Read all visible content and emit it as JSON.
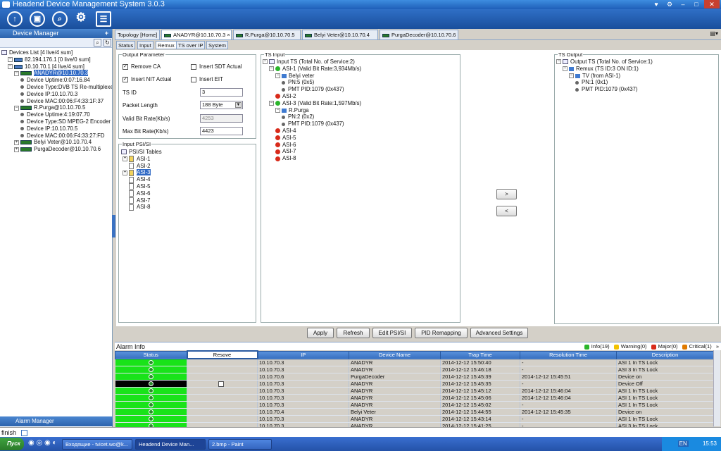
{
  "app": {
    "title": "Headend Device Management System 3.0.3",
    "window_controls": [
      "♥",
      "⚙",
      "–",
      "□",
      "✕"
    ]
  },
  "toolbar": {
    "icons": [
      "signal-icon",
      "monitor-icon",
      "search-icon",
      "settings-icon",
      "report-icon"
    ]
  },
  "left_panel": {
    "header": "Device Manager",
    "plus": "+",
    "tree": [
      {
        "label": "Devices List [4 live/4 sum]",
        "level": 0
      },
      {
        "label": "82.194.176.1 [0 live/0 sum]",
        "level": 1
      },
      {
        "label": "10.10.70.1 [4 live/4 sum]",
        "level": 1
      },
      {
        "label": "ANADYR@10.10.70.3",
        "level": 2,
        "selected": true
      },
      {
        "label": "Device Uptime:0:07:16.84",
        "level": 3
      },
      {
        "label": "Device Type:DVB TS Re-multiplexer",
        "level": 3
      },
      {
        "label": "Device IP:10.10.70.3",
        "level": 3
      },
      {
        "label": "Device MAC:00:06:F4:33:1F:37",
        "level": 3
      },
      {
        "label": "R.Purga@10.10.70.5",
        "level": 2
      },
      {
        "label": "Device Uptime:4:19:07.70",
        "level": 3
      },
      {
        "label": "Device Type:SD MPEG-2 Encoder",
        "level": 3
      },
      {
        "label": "Device IP:10.10.70.5",
        "level": 3
      },
      {
        "label": "Device MAC:00:06:F4:33:27:FD",
        "level": 3
      },
      {
        "label": "Belyi Veter@10.10.70.4",
        "level": 2
      },
      {
        "label": "PurgaDecoder@10.10.70.6",
        "level": 2
      }
    ],
    "alarm_manager": "Alarm Manager"
  },
  "tabs": [
    {
      "label": "Topology [Home]"
    },
    {
      "label": "ANADYR@10.10.70.3",
      "active": true,
      "closable": "×"
    },
    {
      "label": "R.Purga@10.10.70.5"
    },
    {
      "label": "Belyi Veter@10.10.70.4"
    },
    {
      "label": "PurgaDecoder@10.10.70.6"
    }
  ],
  "subtabs": [
    "Status",
    "Input",
    "Remux",
    "TS over IP",
    "System"
  ],
  "output_parameter": {
    "title": "Output Parameter",
    "remove_ca": "Remove CA",
    "insert_sdt": "Insert SDT Actual",
    "insert_nit": "Insert NIT Actual",
    "insert_eit": "Insert EIT",
    "ts_id_label": "TS ID",
    "ts_id": "3",
    "packet_length_label": "Packet Length",
    "packet_length": "188 Byte",
    "valid_bitrate_label": "Valid Bit Rate(Kb/s)",
    "valid_bitrate": "4253",
    "max_bitrate_label": "Max Bit Rate(Kb/s)",
    "max_bitrate": "4423"
  },
  "input_psi": {
    "title": "Input PSI/SI",
    "root": "PSI/SI Tables",
    "items": [
      "ASI-1",
      "ASI-2",
      "ASI-3",
      "ASI-4",
      "ASI-5",
      "ASI-6",
      "ASI-7",
      "ASI-8"
    ]
  },
  "ts_input": {
    "title": "TS Input",
    "lines": [
      {
        "t": "Input TS (Total No. of Service:2)",
        "l": 0,
        "i": "tb"
      },
      {
        "t": "ASI-1 (Valid Bit Rate:3,934Mb/s)",
        "l": 1,
        "i": "g"
      },
      {
        "t": "Belyi veter",
        "l": 2,
        "i": "b"
      },
      {
        "t": "PN:5 (0x5)",
        "l": 3,
        "i": "d"
      },
      {
        "t": "PMT PID:1079 (0x437)",
        "l": 3,
        "i": "d"
      },
      {
        "t": "ASI-2",
        "l": 1,
        "i": "r"
      },
      {
        "t": "ASI-3 (Valid Bit Rate:1,597Mb/s)",
        "l": 1,
        "i": "g"
      },
      {
        "t": "R.Purga",
        "l": 2,
        "i": "b"
      },
      {
        "t": "PN:2 (0x2)",
        "l": 3,
        "i": "d"
      },
      {
        "t": "PMT PID:1079 (0x437)",
        "l": 3,
        "i": "d"
      },
      {
        "t": "ASI-4",
        "l": 1,
        "i": "r"
      },
      {
        "t": "ASI-5",
        "l": 1,
        "i": "r"
      },
      {
        "t": "ASI-6",
        "l": 1,
        "i": "r"
      },
      {
        "t": "ASI-7",
        "l": 1,
        "i": "r"
      },
      {
        "t": "ASI-8",
        "l": 1,
        "i": "r"
      }
    ]
  },
  "ts_output": {
    "title": "TS Output",
    "lines": [
      {
        "t": "Output TS (Total No. of Service:1)",
        "l": 0,
        "i": "tb"
      },
      {
        "t": "Remux (TS ID:3 ON ID:1)",
        "l": 1,
        "i": "b"
      },
      {
        "t": "TV (from ASI-1)",
        "l": 2,
        "i": "b"
      },
      {
        "t": "PN:1 (0x1)",
        "l": 3,
        "i": "d"
      },
      {
        "t": "PMT PID:1079 (0x437)",
        "l": 3,
        "i": "d"
      }
    ]
  },
  "move": {
    "right": ">",
    "left": "<"
  },
  "actions": {
    "apply": "Apply",
    "refresh": "Refresh",
    "edit": "Edit PSI/SI",
    "pid": "PID Remapping",
    "advanced": "Advanced Settings"
  },
  "alarm": {
    "title": "Alarm Info",
    "counts": {
      "info": "Info(19)",
      "warning": "Warning(0)",
      "major": "Major(0)",
      "critical": "Critical(1)"
    },
    "columns": [
      "Status",
      "Resove",
      "IP",
      "Device Name",
      "Trap Time",
      "Resolution Time",
      "Description"
    ],
    "rows": [
      {
        "s": "g",
        "ip": "10.10.70.3",
        "dev": "ANADYR",
        "trap": "2014-12-12 15:50:40",
        "res": "-",
        "desc": "ASI 1 In TS Lock"
      },
      {
        "s": "g",
        "ip": "10.10.70.3",
        "dev": "ANADYR",
        "trap": "2014-12-12 15:46:18",
        "res": "-",
        "desc": "ASI 3 In TS Lock"
      },
      {
        "s": "g",
        "ip": "10.10.70.6",
        "dev": "PurgaDecoder",
        "trap": "2014-12-12 15:45:39",
        "res": "2014-12-12 15:45:51",
        "desc": "Device on"
      },
      {
        "s": "k",
        "ip": "10.10.70.3",
        "dev": "ANADYR",
        "trap": "2014-12-12 15:45:35",
        "res": "-",
        "desc": "Device Off",
        "cb": true
      },
      {
        "s": "g",
        "ip": "10.10.70.3",
        "dev": "ANADYR",
        "trap": "2014-12-12 15:45:12",
        "res": "2014-12-12 15:46:04",
        "desc": "ASI 1 In TS Lock"
      },
      {
        "s": "g",
        "ip": "10.10.70.3",
        "dev": "ANADYR",
        "trap": "2014-12-12 15:45:06",
        "res": "2014-12-12 15:46:04",
        "desc": "ASI 1 In TS Lock"
      },
      {
        "s": "g",
        "ip": "10.10.70.3",
        "dev": "ANADYR",
        "trap": "2014-12-12 15:45:02",
        "res": "-",
        "desc": "ASI 1 In TS Lock"
      },
      {
        "s": "g",
        "ip": "10.10.70.4",
        "dev": "Belyi Veter",
        "trap": "2014-12-12 15:44:55",
        "res": "2014-12-12 15:45:35",
        "desc": "Device on"
      },
      {
        "s": "g",
        "ip": "10.10.70.3",
        "dev": "ANADYR",
        "trap": "2014-12-12 15:43:14",
        "res": "-",
        "desc": "ASI 1 In TS Lock"
      },
      {
        "s": "g",
        "ip": "10.10.70.3",
        "dev": "ANADYR",
        "trap": "2014-12-12 15:41:25",
        "res": "-",
        "desc": "ASI 3 In TS Lock"
      }
    ]
  },
  "statusbar": "finish",
  "taskbar": {
    "start": "Пуск",
    "tasks": [
      "Входящие - tvicet.wo@k...",
      "Headend Device Man...",
      "2.bmp - Paint"
    ],
    "lang": "EN",
    "clock": "15:53"
  },
  "colors": {
    "accent": "#316ac5",
    "ok": "#19e319",
    "critical": "#000000"
  }
}
